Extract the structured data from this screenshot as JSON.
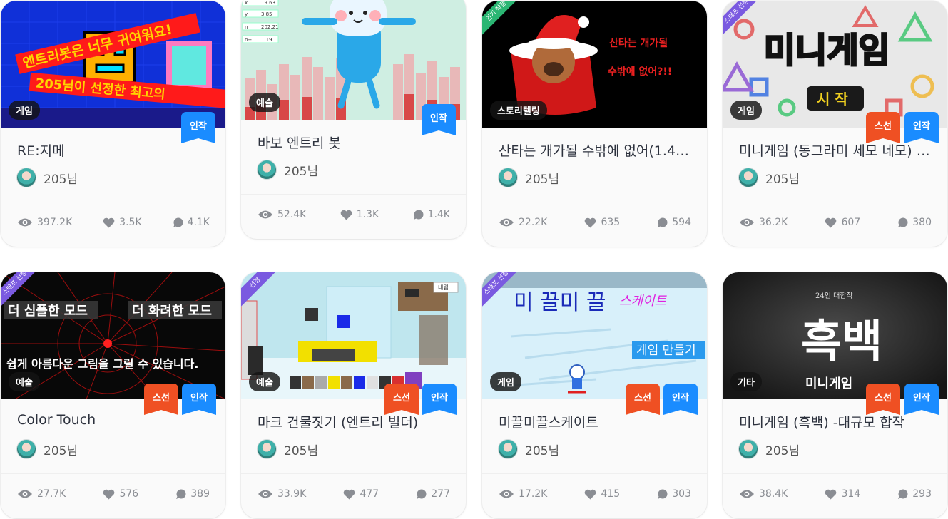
{
  "badges": {
    "original": "인작",
    "staff_pick": "스선"
  },
  "cards": [
    {
      "title": "RE:지메",
      "author": "205님",
      "category": "게임",
      "views": "397.2K",
      "likes": "3.5K",
      "comments": "4.1K",
      "staff_pick": false,
      "corner": ""
    },
    {
      "title": "바보 엔트리 봇",
      "author": "205님",
      "category": "예술",
      "views": "52.4K",
      "likes": "1.3K",
      "comments": "1.4K",
      "staff_pick": false,
      "corner": ""
    },
    {
      "title": "산타는 개가될 수밖에 없어(1.4.…",
      "author": "205님",
      "category": "스토리텔링",
      "views": "22.2K",
      "likes": "635",
      "comments": "594",
      "staff_pick": false,
      "corner": "인기 작품"
    },
    {
      "title": "미니게임 (동그라미 세모 네모) -…",
      "author": "205님",
      "category": "게임",
      "views": "36.2K",
      "likes": "607",
      "comments": "380",
      "staff_pick": true,
      "corner": "스태프 선정"
    },
    {
      "title": "Color Touch",
      "author": "205님",
      "category": "예술",
      "views": "27.7K",
      "likes": "576",
      "comments": "389",
      "staff_pick": true,
      "corner": "스태프 선정"
    },
    {
      "title": "마크 건물짓기 (엔트리 빌더)",
      "author": "205님",
      "category": "예술",
      "views": "33.9K",
      "likes": "477",
      "comments": "277",
      "staff_pick": true,
      "corner": "선정"
    },
    {
      "title": "미끌미끌스케이트",
      "author": "205님",
      "category": "게임",
      "views": "17.2K",
      "likes": "415",
      "comments": "303",
      "staff_pick": true,
      "corner": "스태프 선정"
    },
    {
      "title": "미니게임 (흑백) -대규모 합작",
      "author": "205님",
      "category": "기타",
      "views": "38.4K",
      "likes": "314",
      "comments": "293",
      "staff_pick": true,
      "corner": ""
    }
  ],
  "thumb_text": {
    "c0_a": "엔트리봇은 너무 귀여워요!",
    "c0_b": "205님이 선정한 최고의",
    "c1_vars": [
      "x",
      "19.63",
      "y",
      "3.85",
      "n",
      "202.21",
      "n+",
      "1.19"
    ],
    "c2_a": "산타는 개가될",
    "c2_b": "수밖에 없어?!!",
    "c3_a": "미니게임",
    "c3_b": "시 작",
    "c4_a": "더 심플한 모드",
    "c4_b": "더 화려한 모드",
    "c4_c": "쉽게 아름다운 그림을 그릴 수 있습니다.",
    "c5_a": "내림",
    "c6_a": "미 끌미 끌",
    "c6_b": "스케이트",
    "c6_c": "게임 만들기",
    "c7_a": "24인 대합작",
    "c7_b": "흑백",
    "c7_c": "미니게임"
  },
  "colors": {
    "blue_badge": "#1a8cff",
    "red_badge": "#ef5023",
    "category_bg": "#1f1f1f"
  }
}
